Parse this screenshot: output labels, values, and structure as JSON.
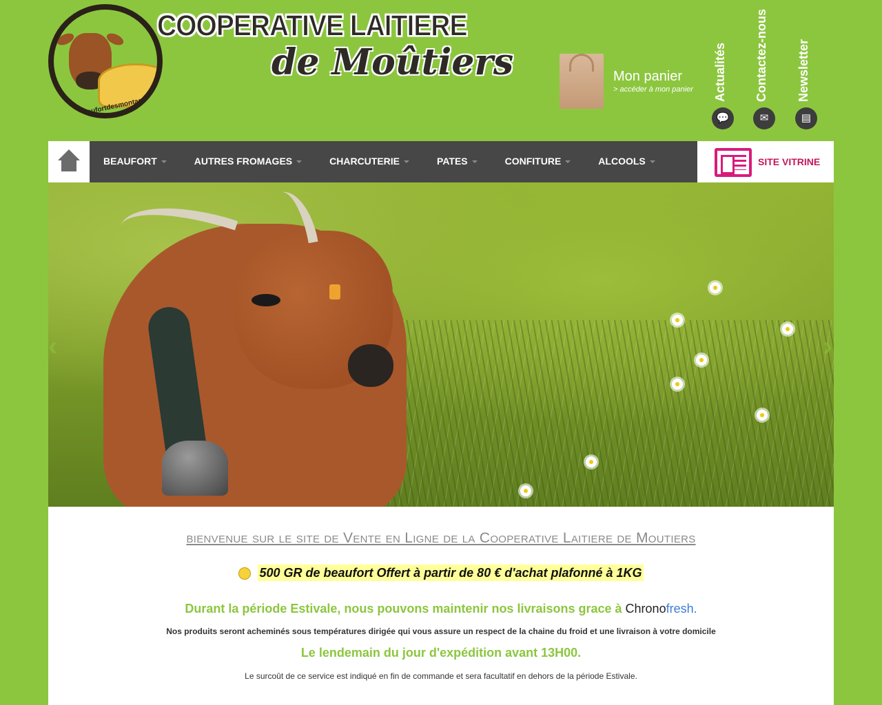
{
  "header": {
    "logo": {
      "title": "COOPERATIVE LAITIERE",
      "subtitle": "de Moûtiers",
      "url_text": "beaufortdesmontagnes.com"
    },
    "cart": {
      "title": "Mon panier",
      "link": "> accéder à mon panier"
    },
    "side_links": [
      {
        "label": "Actualités",
        "icon": "speech-bubble-icon"
      },
      {
        "label": "Contactez-nous",
        "icon": "envelope-icon"
      },
      {
        "label": "Newsletter",
        "icon": "document-icon"
      }
    ]
  },
  "nav": {
    "home_icon": "home-icon",
    "items": [
      {
        "label": "BEAUFORT"
      },
      {
        "label": "AUTRES FROMAGES"
      },
      {
        "label": "CHARCUTERIE"
      },
      {
        "label": "PATES"
      },
      {
        "label": "CONFITURE"
      },
      {
        "label": "ALCOOLS"
      }
    ],
    "vitrine": {
      "label": "SITE VITRINE",
      "icon": "newspaper-icon"
    }
  },
  "carousel": {
    "prev": "‹",
    "next": "›"
  },
  "content": {
    "welcome": "bienvenue sur le site de Vente en Ligne de la Cooperative Laitiere de Moutiers",
    "promo": "500 GR de beaufort Offert à partir de 80 € d'achat plafonné à 1KG",
    "estival_prefix": "Durant la période Estivale, nous pouvons maintenir nos livraisons grace à ",
    "chrono": "Chrono",
    "fresh": "fresh.",
    "products": "Nos produits seront acheminés sous températures dirigée qui vous assure un respect de la chaine du froid et une livraison à votre domicile",
    "lendemain": "Le lendemain du jour d'expédition avant 13H00.",
    "surcout": "Le surcoût de ce service est indiqué en fin de commande et sera facultatif en dehors de la période Estivale."
  },
  "colors": {
    "background": "#8cc63f",
    "nav": "#474747",
    "accent_pink": "#c2185b",
    "highlight": "#ffff99",
    "green_text": "#8cc63f"
  }
}
